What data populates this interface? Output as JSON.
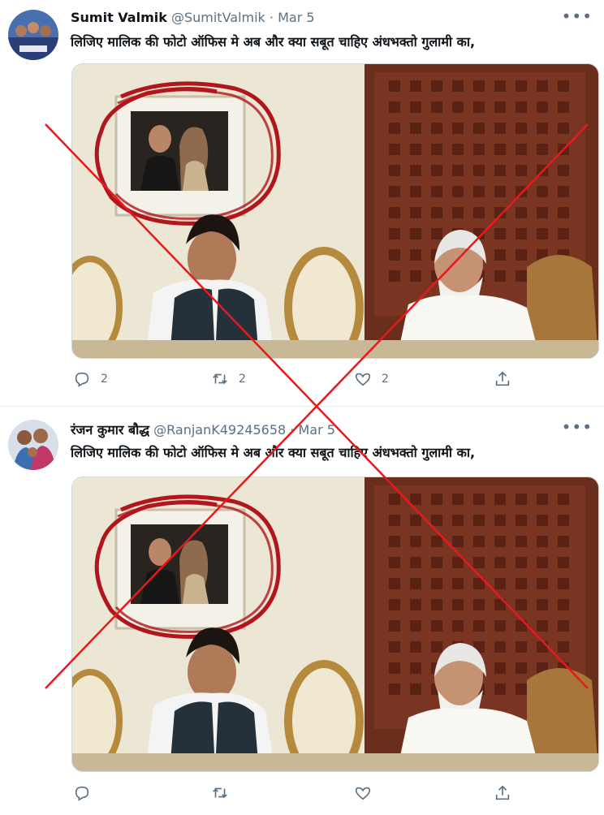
{
  "tweets": [
    {
      "name": "Sumit Valmik",
      "handle": "@SumitValmik",
      "separator": "·",
      "date": "Mar 5",
      "text": "लिजिए मालिक की फोटो ऑफिस मे अब और क्या सबूत चाहिए अंधभक्तो गुलामी का,",
      "replies": "2",
      "retweets": "2",
      "likes": "2"
    },
    {
      "name": "रंजन कुमार बौद्ध",
      "handle": "@RanjanK49245658",
      "separator": "·",
      "date": "Mar 5",
      "text": "लिजिए मालिक की फोटो ऑफिस मे अब और क्या सबूत चाहिए अंधभक्तो गुलामी का,",
      "replies": "",
      "retweets": "",
      "likes": ""
    }
  ],
  "icons": {
    "reply": "reply-icon",
    "retweet": "retweet-icon",
    "like": "heart-icon",
    "share": "share-icon",
    "more": "more-icon"
  },
  "colors": {
    "cross": "#e8191c",
    "circle": "#b0161c",
    "secondary_text": "#5b7083"
  }
}
